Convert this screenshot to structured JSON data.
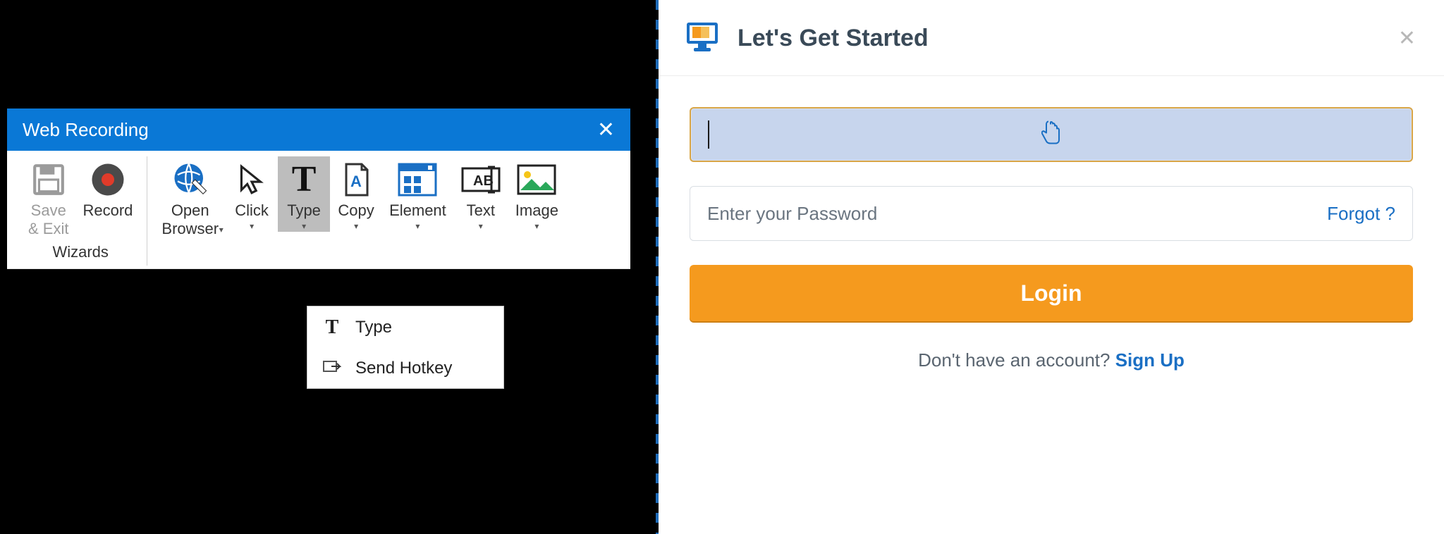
{
  "recording": {
    "title": "Web Recording",
    "groups": [
      {
        "label": "Wizards",
        "buttons": [
          {
            "key": "save_exit",
            "label": "Save\n& Exit",
            "disabled": true,
            "dropdown": false
          },
          {
            "key": "record",
            "label": "Record",
            "disabled": false,
            "dropdown": false
          }
        ]
      },
      {
        "label": "",
        "buttons": [
          {
            "key": "open_browser",
            "label": "Open\nBrowser",
            "dropdown": true
          },
          {
            "key": "click",
            "label": "Click",
            "dropdown": true
          },
          {
            "key": "type",
            "label": "Type",
            "dropdown": true,
            "selected": true
          },
          {
            "key": "copy",
            "label": "Copy",
            "dropdown": true
          },
          {
            "key": "element",
            "label": "Element",
            "dropdown": true
          },
          {
            "key": "text",
            "label": "Text",
            "dropdown": true
          },
          {
            "key": "image",
            "label": "Image",
            "dropdown": true
          }
        ]
      }
    ],
    "type_menu": [
      {
        "key": "type",
        "label": "Type"
      },
      {
        "key": "send_hotkey",
        "label": "Send Hotkey"
      }
    ]
  },
  "login": {
    "title": "Let's Get Started",
    "username_value": "",
    "password_placeholder": "Enter your Password",
    "forgot_label": "Forgot ?",
    "login_button": "Login",
    "signup_prompt": "Don't have an account? ",
    "signup_label": "Sign Up"
  }
}
